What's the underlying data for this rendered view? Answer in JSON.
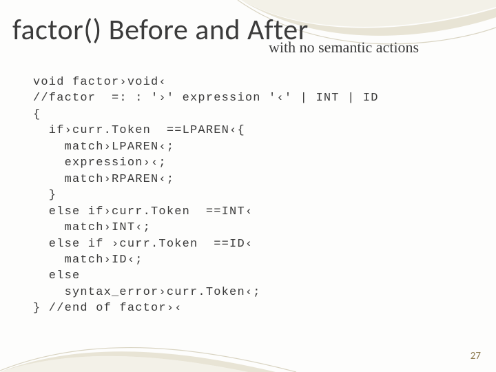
{
  "title": "factor() Before and After",
  "subtitle": "with no semantic actions",
  "code_lines": [
    "void factor›void‹",
    "//factor  =: : '›' expression '‹' | INT | ID",
    "{",
    "  if›curr.Token  ==LPAREN‹{",
    "    match›LPAREN‹;",
    "    expression›‹;",
    "    match›RPAREN‹;",
    "  }",
    "  else if›curr.Token  ==INT‹",
    "    match›INT‹;",
    "  else if ›curr.Token  ==ID‹",
    "    match›ID‹;",
    "  else",
    "    syntax_error›curr.Token‹;",
    "} //end of factor›‹"
  ],
  "page_number": "27",
  "colors": {
    "heading": "#3b3b3b",
    "code": "#3a3a3a",
    "pagenum": "#8d7a4e",
    "swoosh_light": "#f3f1e8",
    "swoosh_mid": "#e8e4d5",
    "swoosh_line": "#d9d4c2"
  }
}
